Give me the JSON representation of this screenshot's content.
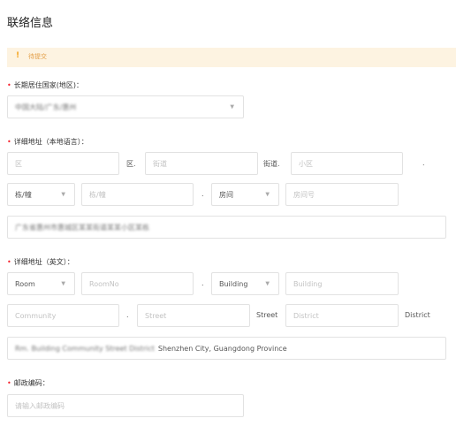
{
  "section_title": "联络信息",
  "notice": {
    "icon": "exclamation-icon",
    "text": "待提交"
  },
  "residence": {
    "label": "长期居住国家(地区)：",
    "value": "中国大陆/广东/惠州",
    "icon": "chevron-down-icon"
  },
  "local_address": {
    "label": "详细地址（本地语言）：",
    "district_placeholder": "区",
    "district_suffix": "区.",
    "street_placeholder": "街道",
    "street_suffix": "街道.",
    "community_placeholder": "小区",
    "community_suffix": ".",
    "building_type_value": "栋/幢",
    "building_placeholder": "栋/幢",
    "building_suffix": ".",
    "room_type_value": "房间",
    "room_placeholder": "房间号",
    "full_address": "广东省惠州市惠城区某某街道某某小区某栋"
  },
  "english_address": {
    "label": "详细地址（英文）：",
    "room_type_value": "Room",
    "room_placeholder": "RoomNo",
    "room_suffix": ".",
    "building_type_value": "Building",
    "building_placeholder": "Building",
    "community_placeholder": "Community",
    "community_suffix": ".",
    "street_placeholder": "Street",
    "street_suffix": "Street",
    "district_placeholder": "District",
    "district_suffix": "District",
    "full_address_hidden": "Rm. Building Community Street District",
    "full_address_visible": "Shenzhen City, Guangdong Province"
  },
  "postal": {
    "label": "邮政编码：",
    "placeholder": "请输入邮政编码"
  },
  "colors": {
    "required": "#f5222d",
    "notice_bg": "#fdf3e1",
    "notice_icon": "#f5a623",
    "border": "#e2e2e2"
  }
}
